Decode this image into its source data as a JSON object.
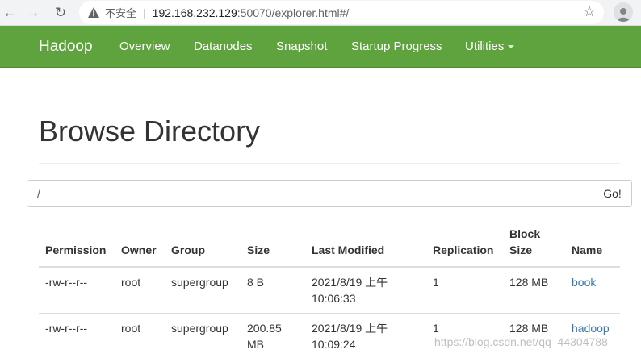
{
  "browser": {
    "security_label": "不安全",
    "url_main": "192.168.232.129",
    "url_rest": ":50070/explorer.html#/"
  },
  "navbar": {
    "brand": "Hadoop",
    "items": [
      "Overview",
      "Datanodes",
      "Snapshot",
      "Startup Progress",
      "Utilities"
    ]
  },
  "page": {
    "title": "Browse Directory",
    "path_value": "/",
    "go_label": "Go!"
  },
  "table": {
    "columns": [
      "Permission",
      "Owner",
      "Group",
      "Size",
      "Last Modified",
      "Replication",
      "Block Size",
      "Name"
    ],
    "rows": [
      [
        "-rw-r--r--",
        "root",
        "supergroup",
        "8 B",
        "2021/8/19 上午 10:06:33",
        "1",
        "128 MB",
        "book"
      ],
      [
        "-rw-r--r--",
        "root",
        "supergroup",
        "200.85 MB",
        "2021/8/19 上午 10:09:24",
        "1",
        "128 MB",
        "hadoop"
      ]
    ]
  },
  "watermark": "https://blog.csdn.net/qq_44304788",
  "colors": {
    "navbar": "#5fa33e",
    "link": "#337ab7"
  }
}
